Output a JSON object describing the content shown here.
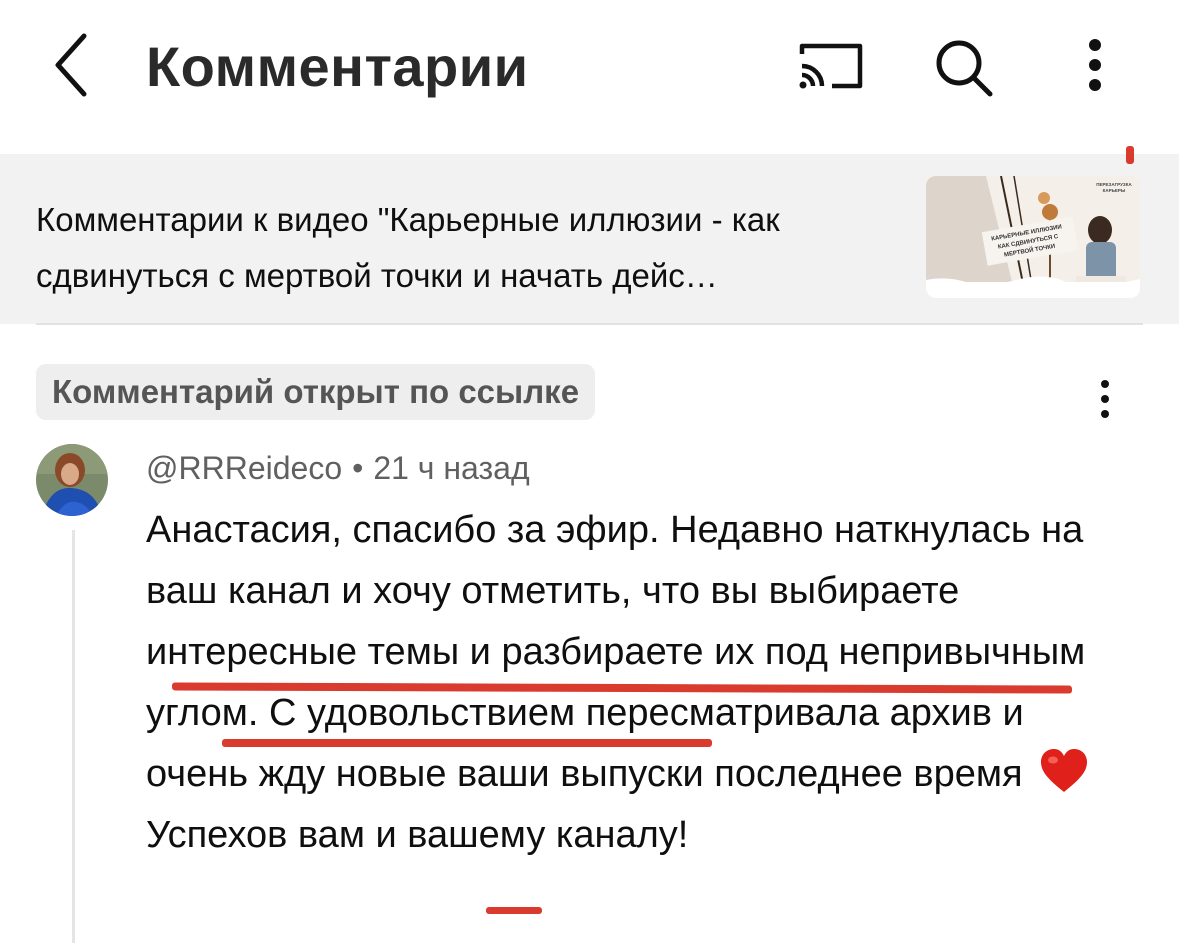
{
  "header": {
    "title": "Комментарии"
  },
  "video_banner": {
    "text": "Комментарии к видео \"Карьерные иллюзии - как сдвинуться с мертвой точки и начать дейс…",
    "thumbnail": {
      "top_label": "ПЕРЕЗАГРУЗКА КАРЬЕРЫ",
      "sign_text": "КАРЬЕРНЫЕ ИЛЛЮЗИИ КАК СДВИНУТЬСЯ С МЕРТВОЙ ТОЧКИ"
    }
  },
  "badge": {
    "label": "Комментарий открыт по ссылке"
  },
  "comment": {
    "author": "@RRReideco",
    "separator": "•",
    "time": "21 ч назад",
    "text_before_heart": "Анастасия, спасибо за эфир. Недавно наткнулась на ваш канал и хочу отметить, что вы выбираете интересные темы и разбираете их под непривычным углом. С удовольствием пересматривала архив и очень жду новые ваши выпуски последнее время",
    "text_after_heart": "Успехов вам и вашему каналу!"
  },
  "icons": {
    "back": "chevron-left-icon",
    "cast": "cast-icon",
    "search": "search-icon",
    "more": "more-vertical-icon",
    "heart": "red-heart-emoji"
  },
  "colors": {
    "annotation_red": "#d62a1c",
    "banner_bg": "#f2f2f2",
    "meta_text": "#606060"
  }
}
